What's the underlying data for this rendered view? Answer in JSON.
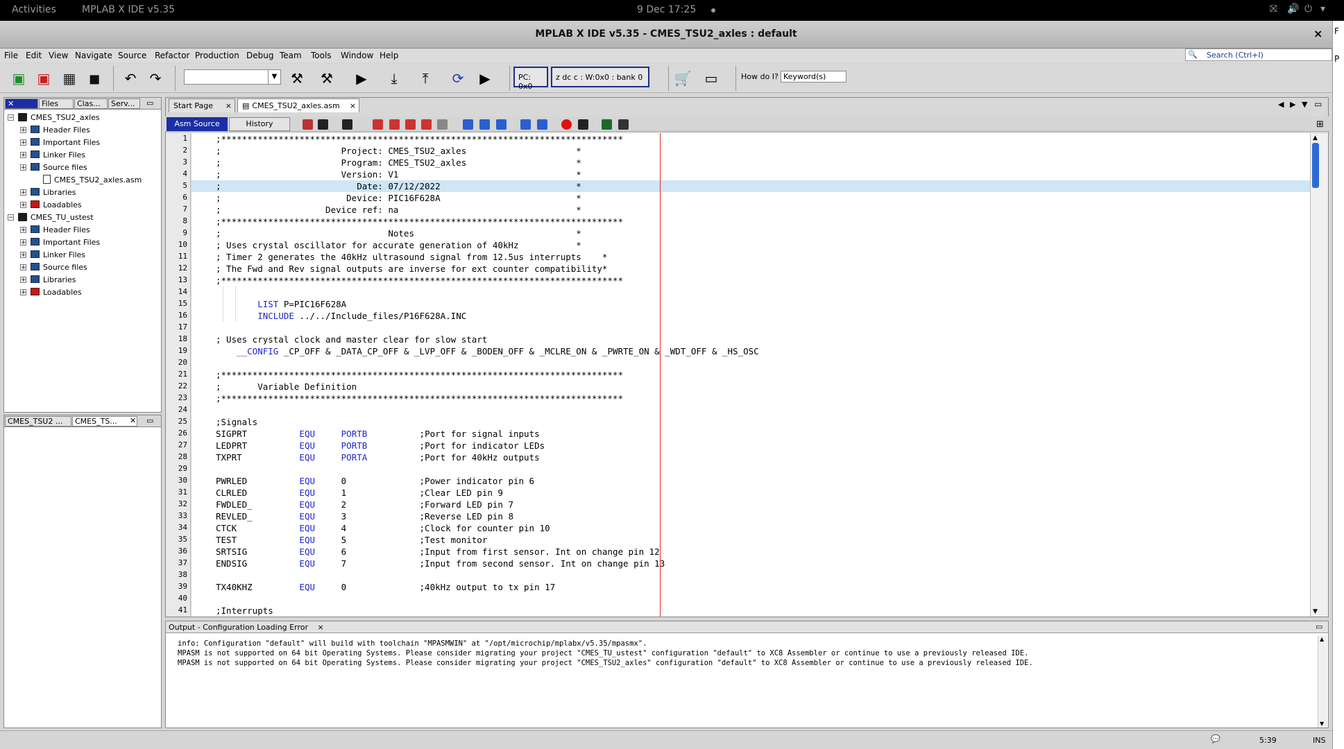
{
  "topbar": {
    "activities": "Activities",
    "app": "MPLAB X IDE v5.35",
    "clock": "9 Dec  17:25"
  },
  "window": {
    "title": "MPLAB X IDE v5.35 - CMES_TSU2_axles : default",
    "close": "×"
  },
  "menu": [
    "File",
    "Edit",
    "View",
    "Navigate",
    "Source",
    "Refactor",
    "Production",
    "Debug",
    "Team",
    "Tools",
    "Window",
    "Help"
  ],
  "search": {
    "placeholder": "Search (Ctrl+I)"
  },
  "toolbar": {
    "pc": "PC: 0x0",
    "status": "z dc c  : W:0x0 : bank 0",
    "howdo": "How do I?",
    "keyword": "Keyword(s)"
  },
  "projects": {
    "tabs": [
      "Files",
      "Clas...",
      "Serv..."
    ],
    "tree": [
      {
        "label": "CMES_TSU2_axles",
        "type": "proj"
      },
      {
        "label": "Header Files",
        "type": "fold"
      },
      {
        "label": "Important Files",
        "type": "fold"
      },
      {
        "label": "Linker Files",
        "type": "fold"
      },
      {
        "label": "Source files",
        "type": "fold"
      },
      {
        "label": "CMES_TSU2_axles.asm",
        "type": "file"
      },
      {
        "label": "Libraries",
        "type": "fold"
      },
      {
        "label": "Loadables",
        "type": "red"
      },
      {
        "label": "CMES_TU_ustest",
        "type": "proj"
      },
      {
        "label": "Header Files",
        "type": "fold"
      },
      {
        "label": "Important Files",
        "type": "fold"
      },
      {
        "label": "Linker Files",
        "type": "fold"
      },
      {
        "label": "Source files",
        "type": "fold"
      },
      {
        "label": "Libraries",
        "type": "fold"
      },
      {
        "label": "Loadables",
        "type": "red"
      }
    ]
  },
  "nav": {
    "tabs": [
      "CMES_TSU2 ...",
      "CMES_TS..."
    ]
  },
  "editor": {
    "tabs": [
      "Start Page",
      "CMES_TSU2_axles.asm"
    ],
    "src_btn": "Asm Source",
    "hist_btn": "History",
    "lines": [
      {
        "n": "1",
        "t": ";*****************************************************************************"
      },
      {
        "n": "2",
        "t": ";                       Project: CMES_TSU2_axles                     *"
      },
      {
        "n": "3",
        "t": ";                       Program: CMES_TSU2_axles                     *"
      },
      {
        "n": "4",
        "t": ";                       Version: V1                                  *"
      },
      {
        "n": "5",
        "t": ";                          Date: 07/12/2022                          *"
      },
      {
        "n": "6",
        "t": ";                        Device: PIC16F628A                          *"
      },
      {
        "n": "7",
        "t": ";                    Device ref: na                                  *"
      },
      {
        "n": "8",
        "t": ";*****************************************************************************"
      },
      {
        "n": "9",
        "t": ";                                Notes                               *"
      },
      {
        "n": "10",
        "t": "; Uses crystal oscillator for accurate generation of 40kHz           *"
      },
      {
        "n": "11",
        "t": "; Timer 2 generates the 40kHz ultrasound signal from 12.5us interrupts    *"
      },
      {
        "n": "12",
        "t": "; The Fwd and Rev signal outputs are inverse for ext counter compatibility*"
      },
      {
        "n": "13",
        "t": ";*****************************************************************************"
      },
      {
        "n": "14",
        "t": ""
      },
      {
        "n": "15",
        "t": "        LIST P=PIC16F628A"
      },
      {
        "n": "16",
        "t": "        INCLUDE ../../Include_files/P16F628A.INC"
      },
      {
        "n": "17",
        "t": ""
      },
      {
        "n": "18",
        "t": "; Uses crystal clock and master clear for slow start"
      },
      {
        "n": "19",
        "t": "    __CONFIG _CP_OFF & _DATA_CP_OFF & _LVP_OFF & _BODEN_OFF & _MCLRE_ON & _PWRTE_ON & _WDT_OFF & _HS_OSC"
      },
      {
        "n": "20",
        "t": ""
      },
      {
        "n": "21",
        "t": ";*****************************************************************************"
      },
      {
        "n": "22",
        "t": ";       Variable Definition"
      },
      {
        "n": "23",
        "t": ";*****************************************************************************"
      },
      {
        "n": "24",
        "t": ""
      },
      {
        "n": "25",
        "t": ";Signals"
      },
      {
        "n": "26",
        "t": "SIGPRT          EQU     PORTB          ;Port for signal inputs"
      },
      {
        "n": "27",
        "t": "LEDPRT          EQU     PORTB          ;Port for indicator LEDs"
      },
      {
        "n": "28",
        "t": "TXPRT           EQU     PORTA          ;Port for 40kHz outputs"
      },
      {
        "n": "29",
        "t": ""
      },
      {
        "n": "30",
        "t": "PWRLED          EQU     0              ;Power indicator pin 6"
      },
      {
        "n": "31",
        "t": "CLRLED          EQU     1              ;Clear LED pin 9"
      },
      {
        "n": "32",
        "t": "FWDLED_         EQU     2              ;Forward LED pin 7"
      },
      {
        "n": "33",
        "t": "REVLED_         EQU     3              ;Reverse LED pin 8"
      },
      {
        "n": "34",
        "t": "CTCK            EQU     4              ;Clock for counter pin 10"
      },
      {
        "n": "35",
        "t": "TEST            EQU     5              ;Test monitor"
      },
      {
        "n": "36",
        "t": "SRTSIG          EQU     6              ;Input from first sensor. Int on change pin 12"
      },
      {
        "n": "37",
        "t": "ENDSIG          EQU     7              ;Input from second sensor. Int on change pin 13"
      },
      {
        "n": "38",
        "t": ""
      },
      {
        "n": "39",
        "t": "TX40KHZ         EQU     0              ;40kHz output to tx pin 17"
      },
      {
        "n": "40",
        "t": ""
      },
      {
        "n": "41",
        "t": ";Interrupts"
      }
    ]
  },
  "output": {
    "title": "Output - Configuration Loading Error",
    "lines": [
      "info: Configuration \"default\" will build with toolchain \"MPASMWIN\" at \"/opt/microchip/mplabx/v5.35/mpasmx\".",
      "MPASM is not supported on 64 bit Operating Systems. Please consider migrating your project \"CMES_TU_ustest\" configuration \"default\" to XC8 Assembler or continue to use a previously released IDE.",
      "MPASM is not supported on 64 bit Operating Systems. Please consider migrating your project \"CMES_TSU2_axles\" configuration \"default\" to XC8 Assembler or continue to use a previously released IDE."
    ]
  },
  "status": {
    "pos": "5:39",
    "mode": "INS"
  },
  "colors": {
    "accent": "#1b2ea6",
    "keyword": "#1f25c9",
    "highlight": "#cfe6f7",
    "margin_line": "#d82b2b"
  }
}
